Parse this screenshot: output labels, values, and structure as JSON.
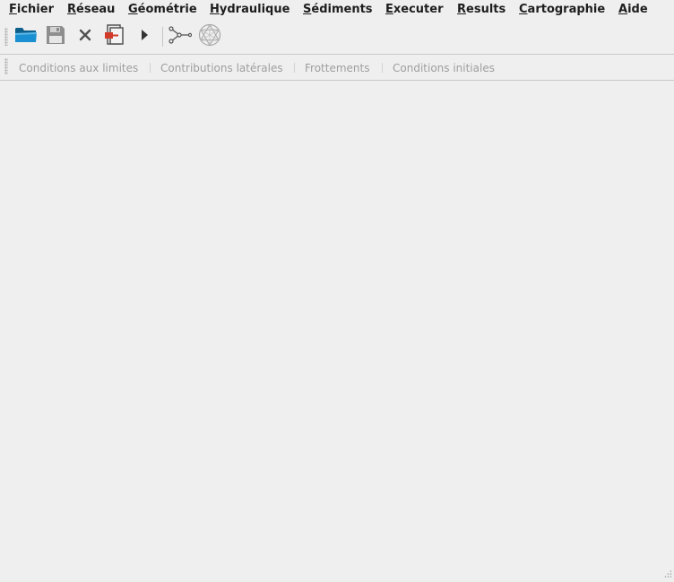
{
  "menubar": {
    "items": [
      {
        "acc": "F",
        "rest": "ichier"
      },
      {
        "acc": "R",
        "rest": "éseau"
      },
      {
        "acc": "G",
        "rest": "éométrie"
      },
      {
        "acc": "H",
        "rest": "ydraulique"
      },
      {
        "acc": "S",
        "rest": "édiments"
      },
      {
        "acc": "E",
        "rest": "xecuter"
      },
      {
        "acc": "R",
        "rest": "esults"
      },
      {
        "acc": "C",
        "rest": "artographie"
      },
      {
        "acc": "A",
        "rest": "ide"
      }
    ]
  },
  "toolbar": {
    "icons": [
      "open-folder-icon",
      "save-icon",
      "close-icon",
      "export-icon",
      "run-icon",
      "network-icon",
      "mesh-icon"
    ]
  },
  "tabs": {
    "items": [
      "Conditions aux limites",
      "Contributions latérales",
      "Frottements",
      "Conditions initiales"
    ],
    "enabled": false
  },
  "colors": {
    "background": "#efefef",
    "folder_blue": "#1a8fd1",
    "disabled_text": "#9e9e9e",
    "export_red": "#d23a2a"
  }
}
